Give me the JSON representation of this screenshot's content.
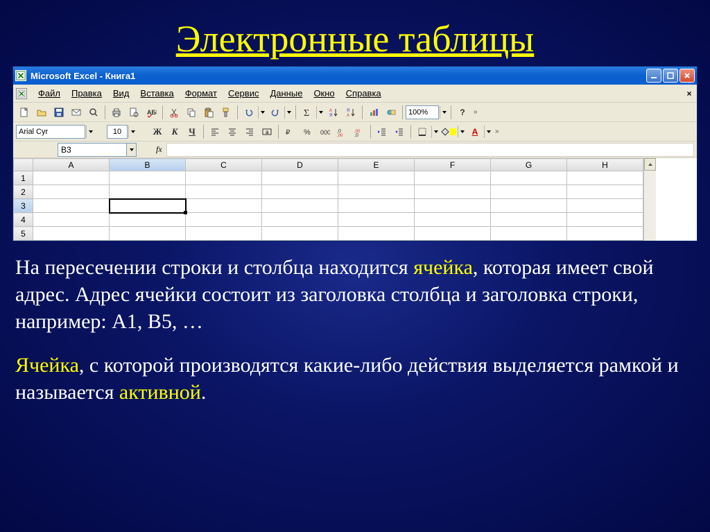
{
  "slide": {
    "title": "Электронные таблицы",
    "paragraph1_a": "На пересечении строки и столбца находится ",
    "paragraph1_hl": "ячейка",
    "paragraph1_b": ", которая имеет свой адрес. Адрес ячейки состоит из заголовка столбца  и заголовка строки, например: А1, В5, …",
    "paragraph2_hl": "Ячейка",
    "paragraph2_a": ",  с которой производятся какие-либо действия выделяется рамкой и называется ",
    "paragraph2_hl2": "активной",
    "paragraph2_end": "."
  },
  "excel": {
    "title": "Microsoft Excel - Книга1",
    "menu": {
      "file": "Файл",
      "edit": "Правка",
      "view": "Вид",
      "insert": "Вставка",
      "format": "Формат",
      "tools": "Сервис",
      "data": "Данные",
      "window": "Окно",
      "help": "Справка"
    },
    "font_name": "Arial Cyr",
    "font_size": "10",
    "zoom": "100%",
    "name_box": "B3",
    "fx": "fx",
    "columns": [
      "A",
      "B",
      "C",
      "D",
      "E",
      "F",
      "G",
      "H"
    ],
    "rows": [
      "1",
      "2",
      "3",
      "4",
      "5"
    ],
    "active_cell": "B3",
    "format_buttons": {
      "bold": "Ж",
      "italic": "К",
      "underline": "Ч"
    }
  }
}
